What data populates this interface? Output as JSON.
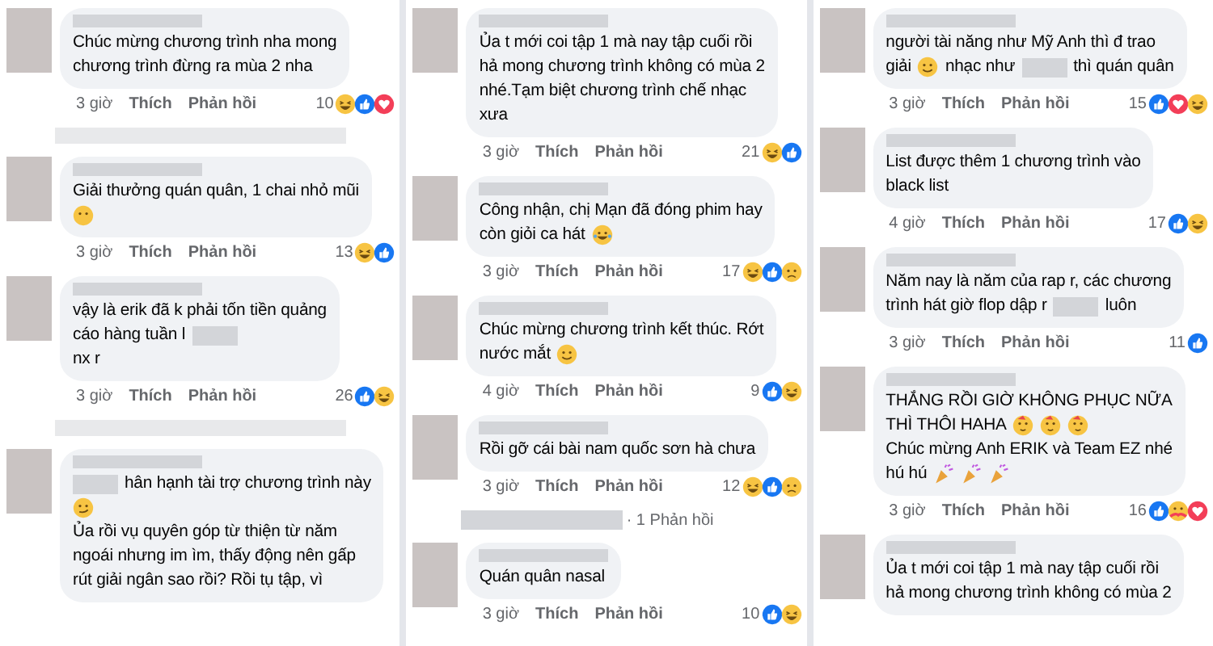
{
  "columns": [
    {
      "items": [
        {
          "kind": "comment",
          "lines": [
            [
              {
                "kind": "text",
                "text": "Chúc mừng chương trình nha mong"
              }
            ],
            [
              {
                "kind": "text",
                "text": "chương trình đừng ra mùa 2 nha"
              }
            ]
          ],
          "time": "3 giờ",
          "like": "Thích",
          "reply": "Phản hồi",
          "count": "10",
          "reactions": [
            {
              "kind": "haha"
            },
            {
              "kind": "like"
            },
            {
              "kind": "love"
            }
          ]
        },
        {
          "kind": "hidden-row"
        },
        {
          "kind": "comment",
          "lines": [
            [
              {
                "kind": "text",
                "text": "Giải thưởng quán quân, 1 chai nhỏ mũi"
              }
            ],
            [
              {
                "kind": "hush"
              }
            ]
          ],
          "time": "3 giờ",
          "like": "Thích",
          "reply": "Phản hồi",
          "count": "13",
          "reactions": [
            {
              "kind": "haha"
            },
            {
              "kind": "like"
            }
          ]
        },
        {
          "kind": "comment",
          "lines": [
            [
              {
                "kind": "text",
                "text": "vậy là erik đã k phải tốn tiền quảng"
              }
            ],
            [
              {
                "kind": "text",
                "text": "cáo hàng tuần l"
              },
              {
                "kind": "redaction"
              }
            ],
            [
              {
                "kind": "text",
                "text": "nx r"
              }
            ]
          ],
          "time": "3 giờ",
          "like": "Thích",
          "reply": "Phản hồi",
          "count": "26",
          "reactions": [
            {
              "kind": "like"
            },
            {
              "kind": "haha"
            }
          ]
        },
        {
          "kind": "hidden-row"
        },
        {
          "kind": "comment",
          "lines": [
            [
              {
                "kind": "redaction"
              },
              {
                "kind": "text",
                "text": "hân hạnh tài trợ chương trình này"
              }
            ],
            [
              {
                "kind": "smirk"
              }
            ],
            [
              {
                "kind": "text",
                "text": "Ủa rồi vụ quyên góp từ thiện  từ năm"
              }
            ],
            [
              {
                "kind": "text",
                "text": "ngoái nhưng im ìm, thấy động nên gấp"
              }
            ],
            [
              {
                "kind": "text",
                "text": "rút giải ngân sao rồi? Rồi tụ tập, vì"
              }
            ]
          ]
        }
      ]
    },
    {
      "items": [
        {
          "kind": "comment",
          "lines": [
            [
              {
                "kind": "text",
                "text": "Ủa t mới coi tập 1 mà nay tập cuối rồi"
              }
            ],
            [
              {
                "kind": "text",
                "text": "hả mong chương trình không có mùa 2"
              }
            ],
            [
              {
                "kind": "text",
                "text": "nhé.Tạm biệt chương trình chế nhạc"
              }
            ],
            [
              {
                "kind": "text",
                "text": "xưa"
              }
            ]
          ],
          "time": "3 giờ",
          "like": "Thích",
          "reply": "Phản hồi",
          "count": "21",
          "reactions": [
            {
              "kind": "haha"
            },
            {
              "kind": "like"
            }
          ]
        },
        {
          "kind": "comment",
          "lines": [
            [
              {
                "kind": "text",
                "text": "Công nhận, chị Mạn đã đóng phim hay"
              }
            ],
            [
              {
                "kind": "text",
                "text": "còn giỏi ca hát"
              },
              {
                "kind": "laugh-cat"
              }
            ]
          ],
          "time": "3 giờ",
          "like": "Thích",
          "reply": "Phản hồi",
          "count": "17",
          "reactions": [
            {
              "kind": "haha"
            },
            {
              "kind": "like"
            },
            {
              "kind": "sad"
            }
          ]
        },
        {
          "kind": "comment",
          "lines": [
            [
              {
                "kind": "text",
                "text": "Chúc mừng chương trình kết thúc. Rớt"
              }
            ],
            [
              {
                "kind": "text",
                "text": "nước mắt"
              },
              {
                "kind": "smile"
              }
            ]
          ],
          "time": "4 giờ",
          "like": "Thích",
          "reply": "Phản hồi",
          "count": "9",
          "reactions": [
            {
              "kind": "like"
            },
            {
              "kind": "haha"
            }
          ]
        },
        {
          "kind": "comment",
          "lines": [
            [
              {
                "kind": "text",
                "text": "Rồi gỡ cái bài nam quốc sơn hà chưa"
              }
            ]
          ],
          "time": "3 giờ",
          "like": "Thích",
          "reply": "Phản hồi",
          "count": "12",
          "reactions": [
            {
              "kind": "haha"
            },
            {
              "kind": "like"
            },
            {
              "kind": "sad"
            }
          ]
        },
        {
          "kind": "replies",
          "text": "· 1 Phản hồi"
        },
        {
          "kind": "comment",
          "lines": [
            [
              {
                "kind": "text",
                "text": "Quán quân nasal"
              }
            ]
          ],
          "time": "3 giờ",
          "like": "Thích",
          "reply": "Phản hồi",
          "count": "10",
          "reactions": [
            {
              "kind": "like"
            },
            {
              "kind": "haha"
            }
          ]
        }
      ]
    },
    {
      "items": [
        {
          "kind": "comment",
          "lines": [
            [
              {
                "kind": "text",
                "text": "người tài năng như Mỹ Anh thì đ trao"
              }
            ],
            [
              {
                "kind": "text",
                "text": "giải"
              },
              {
                "kind": "smile"
              },
              {
                "kind": "text",
                "text": "nhạc như"
              },
              {
                "kind": "redaction"
              },
              {
                "kind": "text",
                "text": "thì quán quân"
              }
            ]
          ],
          "time": "3 giờ",
          "like": "Thích",
          "reply": "Phản hồi",
          "count": "15",
          "reactions": [
            {
              "kind": "like"
            },
            {
              "kind": "love"
            },
            {
              "kind": "haha"
            }
          ]
        },
        {
          "kind": "comment",
          "lines": [
            [
              {
                "kind": "text",
                "text": "List được thêm 1 chương trình vào"
              }
            ],
            [
              {
                "kind": "text",
                "text": "black list"
              }
            ]
          ],
          "time": "4 giờ",
          "like": "Thích",
          "reply": "Phản hồi",
          "count": "17",
          "reactions": [
            {
              "kind": "like"
            },
            {
              "kind": "haha"
            }
          ]
        },
        {
          "kind": "comment",
          "lines": [
            [
              {
                "kind": "text",
                "text": "Năm nay là năm của rap r, các chương"
              }
            ],
            [
              {
                "kind": "text",
                "text": "trình hát giờ flop dập r"
              },
              {
                "kind": "redaction"
              },
              {
                "kind": "text",
                "text": "luôn"
              }
            ]
          ],
          "time": "3 giờ",
          "like": "Thích",
          "reply": "Phản hồi",
          "count": "11",
          "reactions": [
            {
              "kind": "like"
            }
          ]
        },
        {
          "kind": "comment",
          "lines": [
            [
              {
                "kind": "text",
                "text": "THẮNG RỒI GIỜ KHÔNG PHỤC NỮA"
              }
            ],
            [
              {
                "kind": "text",
                "text": "THÌ THÔI HAHA"
              },
              {
                "kind": "party"
              },
              {
                "kind": "party"
              },
              {
                "kind": "party"
              }
            ],
            [
              {
                "kind": "text",
                "text": "Chúc mừng Anh ERIK và Team EZ nhé"
              }
            ],
            [
              {
                "kind": "text",
                "text": "hú hú"
              },
              {
                "kind": "popper"
              },
              {
                "kind": "popper"
              },
              {
                "kind": "popper"
              }
            ]
          ],
          "time": "3 giờ",
          "like": "Thích",
          "reply": "Phản hồi",
          "count": "16",
          "reactions": [
            {
              "kind": "like"
            },
            {
              "kind": "care"
            },
            {
              "kind": "love"
            }
          ]
        },
        {
          "kind": "comment",
          "lines": [
            [
              {
                "kind": "text",
                "text": "Ủa t mới coi tập 1 mà nay tập cuối rồi"
              }
            ],
            [
              {
                "kind": "text",
                "text": "hả mong chương trình không có mùa 2"
              }
            ]
          ]
        }
      ]
    }
  ]
}
